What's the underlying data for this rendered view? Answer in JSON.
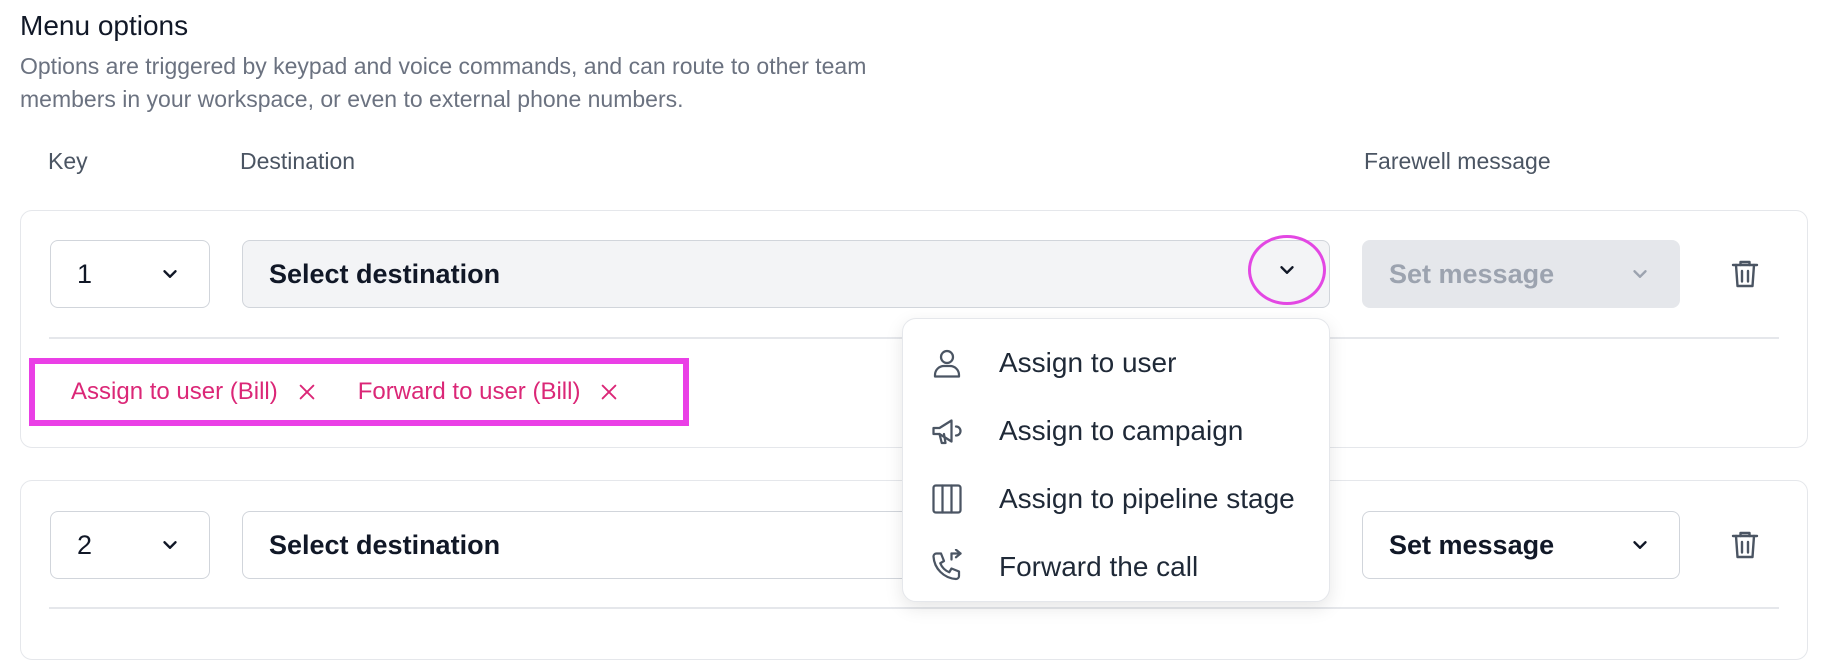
{
  "section": {
    "title": "Menu options",
    "description": "Options are triggered by keypad and voice commands, and can route to other team members in your workspace, or even to external phone numbers."
  },
  "columns": {
    "key": "Key",
    "destination": "Destination",
    "farewell": "Farewell message"
  },
  "rows": [
    {
      "key": "1",
      "destination_placeholder": "Select destination",
      "message_placeholder": "Set message",
      "tags": [
        {
          "label": "Assign to user (Bill)"
        },
        {
          "label": "Forward to user (Bill)"
        }
      ]
    },
    {
      "key": "2",
      "destination_placeholder": "Select destination",
      "message_placeholder": "Set message"
    }
  ],
  "dropdown": {
    "items": [
      {
        "label": "Assign to user",
        "icon": "user-icon"
      },
      {
        "label": "Assign to campaign",
        "icon": "megaphone-icon"
      },
      {
        "label": "Assign to pipeline stage",
        "icon": "columns-icon"
      },
      {
        "label": "Forward the call",
        "icon": "phone-forward-icon"
      }
    ]
  },
  "colors": {
    "highlight": "#ea3fe6",
    "tag_text": "#db2777",
    "muted_text": "#6b7280"
  }
}
